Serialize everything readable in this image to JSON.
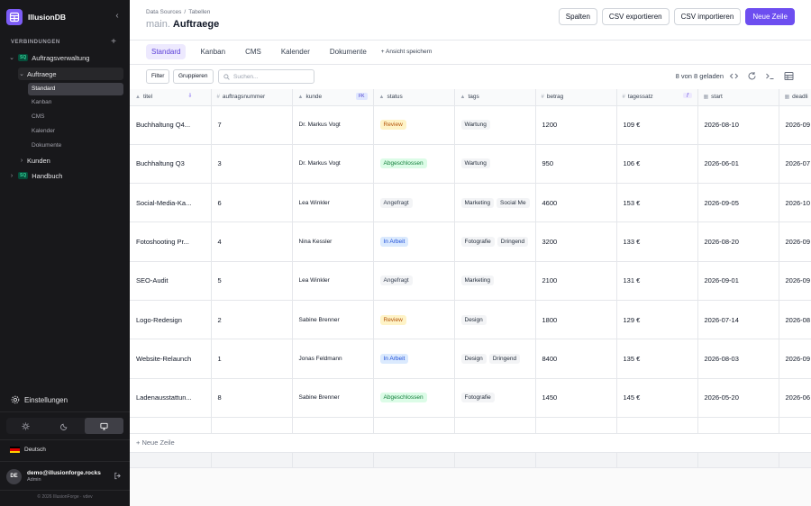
{
  "app": {
    "name": "IllusionDB"
  },
  "sidebar": {
    "section_label": "VERBINDUNGEN",
    "connections": [
      {
        "badge": "SQ",
        "label": "Auftragsverwaltung"
      },
      {
        "badge": "SQ",
        "label": "Handbuch"
      }
    ],
    "table_active": "Auftraege",
    "views": [
      "Standard",
      "Kanban",
      "CMS",
      "Kalender",
      "Dokumente"
    ],
    "table_other": "Kunden",
    "settings_label": "Einstellungen",
    "language": "Deutsch",
    "user": {
      "initials": "DE",
      "email": "demo@illusionforge.rocks",
      "role": "Admin"
    },
    "footer": "© 2026 IllusionForge · vdev"
  },
  "header": {
    "breadcrumb": [
      "Data Sources",
      "Tabellen"
    ],
    "schema": "main.",
    "title": "Auftraege",
    "actions": {
      "columns": "Spalten",
      "export": "CSV exportieren",
      "import": "CSV importieren",
      "new_row": "Neue Zeile"
    }
  },
  "tabs": [
    "Standard",
    "Kanban",
    "CMS",
    "Kalender",
    "Dokumente"
  ],
  "save_view": "+ Ansicht speichern",
  "toolbar": {
    "filter": "Filter",
    "group": "Gruppieren",
    "search_placeholder": "Suchen...",
    "loaded": "8 von 8 geladen"
  },
  "columns": [
    {
      "icon": "▲",
      "label": "titel"
    },
    {
      "icon": "#",
      "label": "auftragsnummer"
    },
    {
      "icon": "▲",
      "label": "kunde",
      "tag": "FK"
    },
    {
      "icon": "▲",
      "label": "status"
    },
    {
      "icon": "▲",
      "label": "tags"
    },
    {
      "icon": "#",
      "label": "betrag"
    },
    {
      "icon": "#",
      "label": "tagessatz",
      "tag": "ƒ"
    },
    {
      "icon": "▦",
      "label": "start"
    },
    {
      "icon": "▦",
      "label": "deadli"
    }
  ],
  "rows": [
    {
      "titel": "Buchhaltung Q4...",
      "nr": "7",
      "kunde": "Dr. Markus Vogt",
      "status": "Review",
      "tags": [
        "Wartung"
      ],
      "betrag": "1200",
      "tagessatz": "109 €",
      "start": "2026-08-10",
      "deadline": "2026-09"
    },
    {
      "titel": "Buchhaltung Q3",
      "nr": "3",
      "kunde": "Dr. Markus Vogt",
      "status": "Abgeschlossen",
      "tags": [
        "Wartung"
      ],
      "betrag": "950",
      "tagessatz": "106 €",
      "start": "2026-06-01",
      "deadline": "2026-07"
    },
    {
      "titel": "Social-Media-Ka...",
      "nr": "6",
      "kunde": "Lea Winkler",
      "status": "Angefragt",
      "tags": [
        "Marketing",
        "Social Me"
      ],
      "betrag": "4600",
      "tagessatz": "153 €",
      "start": "2026-09-05",
      "deadline": "2026-10"
    },
    {
      "titel": "Fotoshooting Pr...",
      "nr": "4",
      "kunde": "Nina Kessler",
      "status": "In Arbeit",
      "tags": [
        "Fotografie",
        "Dringend"
      ],
      "betrag": "3200",
      "tagessatz": "133 €",
      "start": "2026-08-20",
      "deadline": "2026-09"
    },
    {
      "titel": "SEO-Audit",
      "nr": "5",
      "kunde": "Lea Winkler",
      "status": "Angefragt",
      "tags": [
        "Marketing"
      ],
      "betrag": "2100",
      "tagessatz": "131 €",
      "start": "2026-09-01",
      "deadline": "2026-09"
    },
    {
      "titel": "Logo-Redesign",
      "nr": "2",
      "kunde": "Sabine Brenner",
      "status": "Review",
      "tags": [
        "Design"
      ],
      "betrag": "1800",
      "tagessatz": "129 €",
      "start": "2026-07-14",
      "deadline": "2026-08"
    },
    {
      "titel": "Website-Relaunch",
      "nr": "1",
      "kunde": "Jonas Feldmann",
      "status": "In Arbeit",
      "tags": [
        "Design",
        "Dringend"
      ],
      "betrag": "8400",
      "tagessatz": "135 €",
      "start": "2026-08-03",
      "deadline": "2026-09"
    },
    {
      "titel": "Ladenausstattun...",
      "nr": "8",
      "kunde": "Sabine Brenner",
      "status": "Abgeschlossen",
      "tags": [
        "Fotografie"
      ],
      "betrag": "1450",
      "tagessatz": "145 €",
      "start": "2026-05-20",
      "deadline": "2026-06"
    }
  ],
  "new_row_label": "+ Neue Zeile",
  "colors": {
    "accent": "#6d4ef0",
    "sidebar_bg": "#18181b",
    "review": "#b45309",
    "done": "#15803d",
    "in_progress": "#1d4ed8"
  },
  "icons": [
    "database-logo-icon",
    "chevron-left-icon",
    "plus-icon",
    "gear-icon",
    "sun-icon",
    "moon-icon",
    "monitor-icon",
    "logout-icon",
    "search-icon",
    "code-icon",
    "refresh-icon",
    "terminal-icon",
    "grid-icon"
  ]
}
